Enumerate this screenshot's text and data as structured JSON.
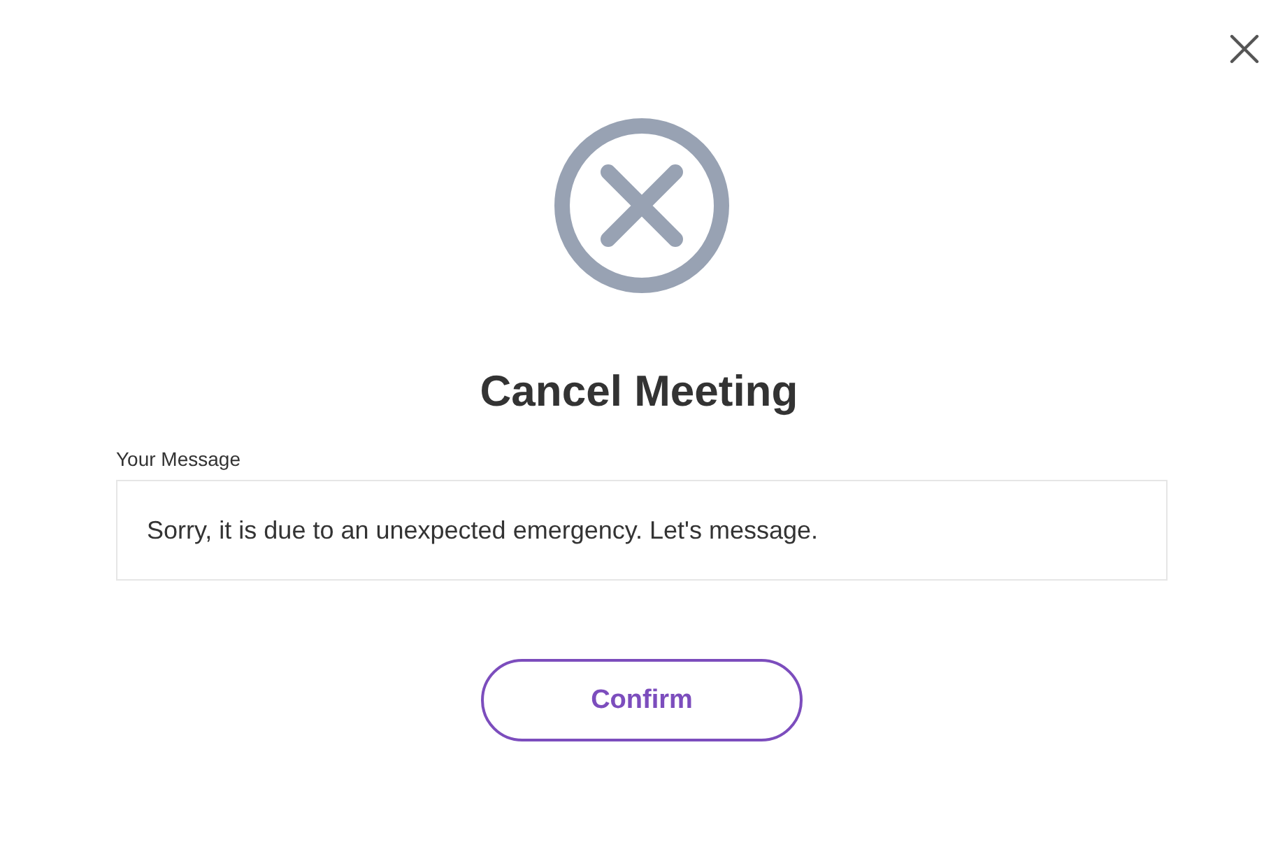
{
  "dialog": {
    "title": "Cancel Meeting",
    "message_field": {
      "label": "Your Message",
      "value": "Sorry, it is due to an unexpected emergency. Let's message."
    },
    "buttons": [
      "Confirm"
    ]
  }
}
